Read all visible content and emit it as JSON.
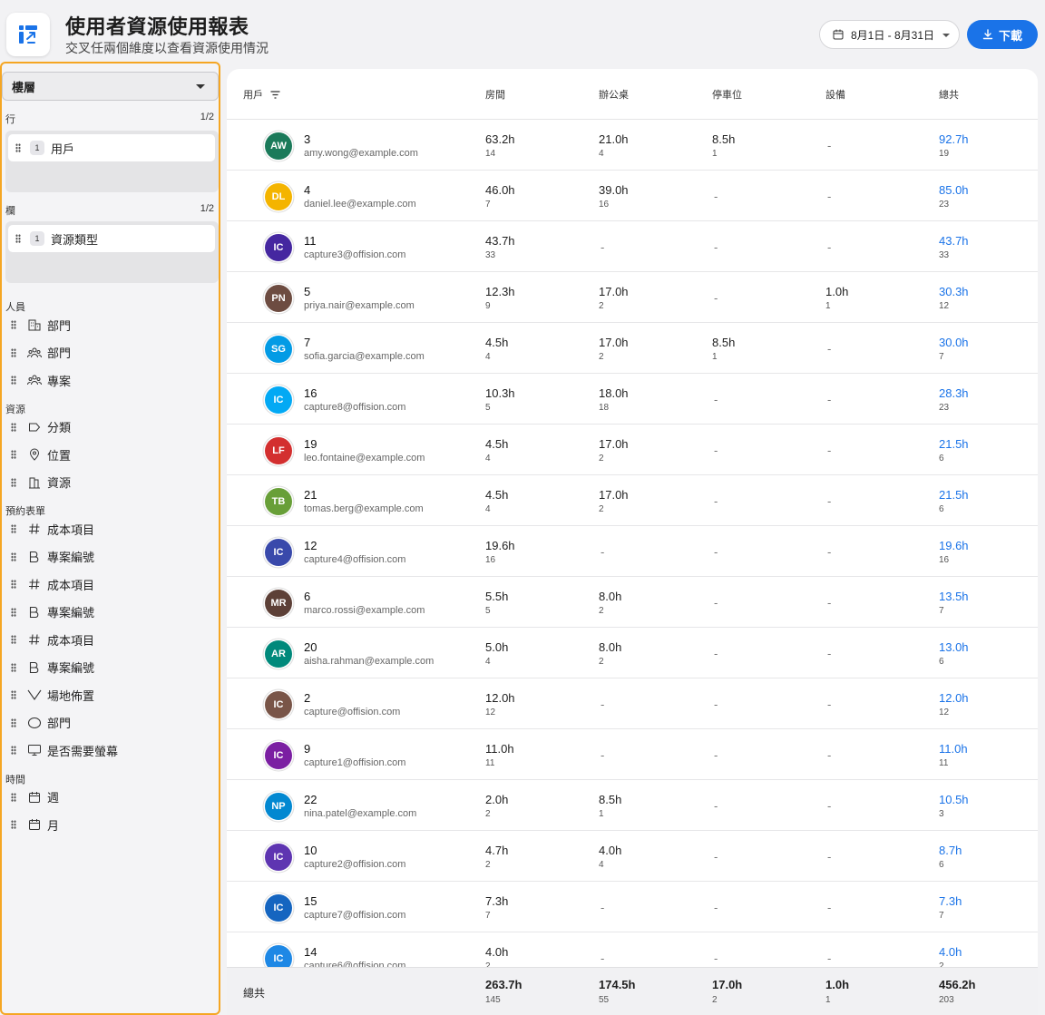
{
  "header": {
    "title": "使用者資源使用報表",
    "subtitle": "交叉任兩個維度以查看資源使用情況",
    "date_range": "8月1日 - 8月31日",
    "download_label": "下載"
  },
  "colors": {
    "accent": "#1a73e8",
    "highlight_border": "#f5a623"
  },
  "sidebar": {
    "floor_select": "樓層",
    "rows_label": "行",
    "rows_count": "1/2",
    "row_item": {
      "index": "1",
      "label": "用戶"
    },
    "cols_label": "欄",
    "cols_count": "1/2",
    "col_item": {
      "index": "1",
      "label": "資源類型"
    },
    "groups": [
      {
        "label": "人員",
        "items": [
          {
            "icon": "building-icon",
            "label": "部門"
          },
          {
            "icon": "people-icon",
            "label": "部門"
          },
          {
            "icon": "people-icon",
            "label": "專案"
          }
        ]
      },
      {
        "label": "資源",
        "items": [
          {
            "icon": "tag-icon",
            "label": "分類"
          },
          {
            "icon": "location-pin-icon",
            "label": "位置"
          },
          {
            "icon": "resource-icon",
            "label": "資源"
          }
        ]
      },
      {
        "label": "預約表單",
        "items": [
          {
            "icon": "hash-icon",
            "label": "成本項目"
          },
          {
            "icon": "bold-b-icon",
            "label": "專案編號"
          },
          {
            "icon": "hash-icon",
            "label": "成本項目"
          },
          {
            "icon": "bold-b-icon",
            "label": "專案編號"
          },
          {
            "icon": "hash-icon",
            "label": "成本項目"
          },
          {
            "icon": "bold-b-icon",
            "label": "專案編號"
          },
          {
            "icon": "chevron-v-icon",
            "label": "場地佈置"
          },
          {
            "icon": "circle-icon",
            "label": "部門"
          },
          {
            "icon": "monitor-icon",
            "label": "是否需要螢幕"
          }
        ]
      },
      {
        "label": "時間",
        "items": [
          {
            "icon": "calendar-icon",
            "label": "週"
          },
          {
            "icon": "calendar-icon",
            "label": "月"
          }
        ]
      }
    ]
  },
  "table": {
    "columns": [
      "用戶",
      "房間",
      "辦公桌",
      "停車位",
      "設備",
      "總共"
    ],
    "rows": [
      {
        "initials": "AW",
        "color": "#1b7a5a",
        "name": "3",
        "email": "amy.wong@example.com",
        "cells": [
          [
            "63.2h",
            "14"
          ],
          [
            "21.0h",
            "4"
          ],
          [
            "8.5h",
            "1"
          ],
          null
        ],
        "total": [
          "92.7h",
          "19"
        ]
      },
      {
        "initials": "DL",
        "color": "#f4b400",
        "name": "4",
        "email": "daniel.lee@example.com",
        "cells": [
          [
            "46.0h",
            "7"
          ],
          [
            "39.0h",
            "16"
          ],
          null,
          null
        ],
        "total": [
          "85.0h",
          "23"
        ]
      },
      {
        "initials": "IC",
        "color": "#4527a0",
        "name": "11",
        "email": "capture3@offision.com",
        "cells": [
          [
            "43.7h",
            "33"
          ],
          null,
          null,
          null
        ],
        "total": [
          "43.7h",
          "33"
        ]
      },
      {
        "initials": "PN",
        "color": "#6d4c41",
        "name": "5",
        "email": "priya.nair@example.com",
        "cells": [
          [
            "12.3h",
            "9"
          ],
          [
            "17.0h",
            "2"
          ],
          null,
          [
            "1.0h",
            "1"
          ]
        ],
        "total": [
          "30.3h",
          "12"
        ]
      },
      {
        "initials": "SG",
        "color": "#039be5",
        "name": "7",
        "email": "sofia.garcia@example.com",
        "cells": [
          [
            "4.5h",
            "4"
          ],
          [
            "17.0h",
            "2"
          ],
          [
            "8.5h",
            "1"
          ],
          null
        ],
        "total": [
          "30.0h",
          "7"
        ]
      },
      {
        "initials": "IC",
        "color": "#03a9f4",
        "name": "16",
        "email": "capture8@offision.com",
        "cells": [
          [
            "10.3h",
            "5"
          ],
          [
            "18.0h",
            "18"
          ],
          null,
          null
        ],
        "total": [
          "28.3h",
          "23"
        ]
      },
      {
        "initials": "LF",
        "color": "#d32f2f",
        "name": "19",
        "email": "leo.fontaine@example.com",
        "cells": [
          [
            "4.5h",
            "4"
          ],
          [
            "17.0h",
            "2"
          ],
          null,
          null
        ],
        "total": [
          "21.5h",
          "6"
        ]
      },
      {
        "initials": "TB",
        "color": "#689f38",
        "name": "21",
        "email": "tomas.berg@example.com",
        "cells": [
          [
            "4.5h",
            "4"
          ],
          [
            "17.0h",
            "2"
          ],
          null,
          null
        ],
        "total": [
          "21.5h",
          "6"
        ]
      },
      {
        "initials": "IC",
        "color": "#3949ab",
        "name": "12",
        "email": "capture4@offision.com",
        "cells": [
          [
            "19.6h",
            "16"
          ],
          null,
          null,
          null
        ],
        "total": [
          "19.6h",
          "16"
        ]
      },
      {
        "initials": "MR",
        "color": "#5d4037",
        "name": "6",
        "email": "marco.rossi@example.com",
        "cells": [
          [
            "5.5h",
            "5"
          ],
          [
            "8.0h",
            "2"
          ],
          null,
          null
        ],
        "total": [
          "13.5h",
          "7"
        ]
      },
      {
        "initials": "AR",
        "color": "#00897b",
        "name": "20",
        "email": "aisha.rahman@example.com",
        "cells": [
          [
            "5.0h",
            "4"
          ],
          [
            "8.0h",
            "2"
          ],
          null,
          null
        ],
        "total": [
          "13.0h",
          "6"
        ]
      },
      {
        "initials": "IC",
        "color": "#795548",
        "name": "2",
        "email": "capture@offision.com",
        "cells": [
          [
            "12.0h",
            "12"
          ],
          null,
          null,
          null
        ],
        "total": [
          "12.0h",
          "12"
        ]
      },
      {
        "initials": "IC",
        "color": "#7b1fa2",
        "name": "9",
        "email": "capture1@offision.com",
        "cells": [
          [
            "11.0h",
            "11"
          ],
          null,
          null,
          null
        ],
        "total": [
          "11.0h",
          "11"
        ]
      },
      {
        "initials": "NP",
        "color": "#0288d1",
        "name": "22",
        "email": "nina.patel@example.com",
        "cells": [
          [
            "2.0h",
            "2"
          ],
          [
            "8.5h",
            "1"
          ],
          null,
          null
        ],
        "total": [
          "10.5h",
          "3"
        ]
      },
      {
        "initials": "IC",
        "color": "#5e35b1",
        "name": "10",
        "email": "capture2@offision.com",
        "cells": [
          [
            "4.7h",
            "2"
          ],
          [
            "4.0h",
            "4"
          ],
          null,
          null
        ],
        "total": [
          "8.7h",
          "6"
        ]
      },
      {
        "initials": "IC",
        "color": "#1565c0",
        "name": "15",
        "email": "capture7@offision.com",
        "cells": [
          [
            "7.3h",
            "7"
          ],
          null,
          null,
          null
        ],
        "total": [
          "7.3h",
          "7"
        ]
      },
      {
        "initials": "IC",
        "color": "#1e88e5",
        "name": "14",
        "email": "capture6@offision.com",
        "cells": [
          [
            "4.0h",
            "2"
          ],
          null,
          null,
          null
        ],
        "total": [
          "4.0h",
          "2"
        ]
      }
    ],
    "footer": {
      "label": "總共",
      "values": [
        [
          "263.7h",
          "145"
        ],
        [
          "174.5h",
          "55"
        ],
        [
          "17.0h",
          "2"
        ],
        [
          "1.0h",
          "1"
        ],
        [
          "456.2h",
          "203"
        ]
      ]
    }
  }
}
